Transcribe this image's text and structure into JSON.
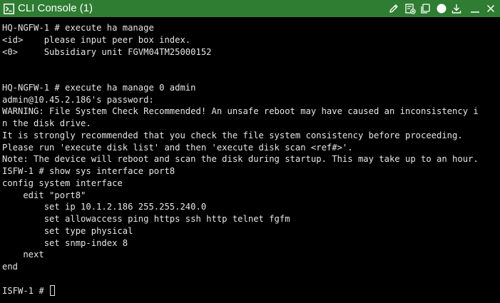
{
  "window": {
    "title": "CLI Console (1)",
    "accent_color": "#2e7d32",
    "icons": {
      "title": "terminal-icon",
      "edit": "pencil-icon",
      "clear": "clear-console-icon",
      "copy": "copy-icon",
      "theme": "theme-toggle-icon",
      "download": "download-icon",
      "minimize": "minimize-icon",
      "close": "close-icon"
    }
  },
  "terminal": {
    "lines": [
      "HQ-NGFW-1 # execute ha manage",
      "<id>    please input peer box index.",
      "<0>     Subsidiary unit FGVM04TM25000152",
      "",
      "",
      "HQ-NGFW-1 # execute ha manage 0 admin",
      "admin@10.45.2.186's password:",
      "WARNING: File System Check Recommended! An unsafe reboot may have caused an inconsistency i",
      "n the disk drive.",
      "It is strongly recommended that you check the file system consistency before proceeding.",
      "Please run 'execute disk list' and then 'execute disk scan <ref#>'.",
      "Note: The device will reboot and scan the disk during startup. This may take up to an hour.",
      "ISFW-1 # show sys interface port8",
      "config system interface",
      "    edit \"port8\"",
      "        set ip 10.1.2.186 255.255.240.0",
      "        set allowaccess ping https ssh http telnet fgfm",
      "        set type physical",
      "        set snmp-index 8",
      "    next",
      "end",
      ""
    ],
    "prompt": "ISFW-1 # "
  }
}
